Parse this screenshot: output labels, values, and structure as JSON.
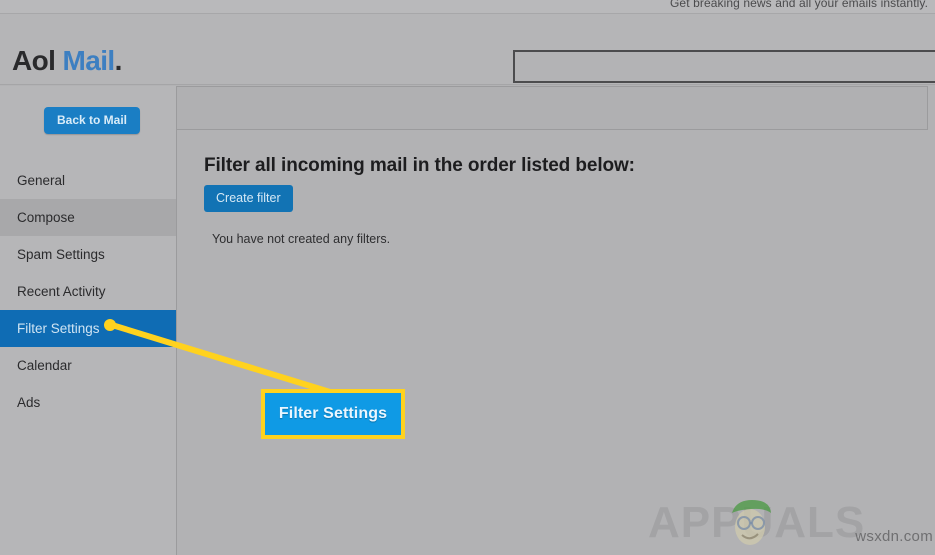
{
  "promo": {
    "text": "Get breaking news and all your emails instantly."
  },
  "masthead": {
    "brand_primary": "Aol",
    "brand_secondary": "Mail",
    "brand_dot": ".",
    "search": {
      "value": "",
      "placeholder": ""
    }
  },
  "sidebar": {
    "back_button": "Back to Mail",
    "items": [
      {
        "label": "General",
        "state": "normal"
      },
      {
        "label": "Compose",
        "state": "hover"
      },
      {
        "label": "Spam Settings",
        "state": "normal"
      },
      {
        "label": "Recent Activity",
        "state": "normal"
      },
      {
        "label": "Filter Settings",
        "state": "selected"
      },
      {
        "label": "Calendar",
        "state": "normal"
      },
      {
        "label": "Ads",
        "state": "normal"
      }
    ]
  },
  "main": {
    "heading": "Filter all incoming mail in the order listed below:",
    "create_filter_label": "Create filter",
    "empty_message": "You have not created any filters."
  },
  "annotation": {
    "callout_label": "Filter Settings",
    "arrow_color": "#ffd21e",
    "callout_fill": "#0f9ae5",
    "callout_border": "#ffd21e"
  },
  "watermark": {
    "brand": "APPUALS",
    "site": "wsxdn.com"
  },
  "colors": {
    "page_background": "#b2b2b4",
    "sidebar_background": "#b6b6b8",
    "selected_nav": "#0f6cb4",
    "hover_nav": "#a8a8aa",
    "button_blue": "#1a7ec4",
    "brand_blue": "#3d7fc1"
  }
}
